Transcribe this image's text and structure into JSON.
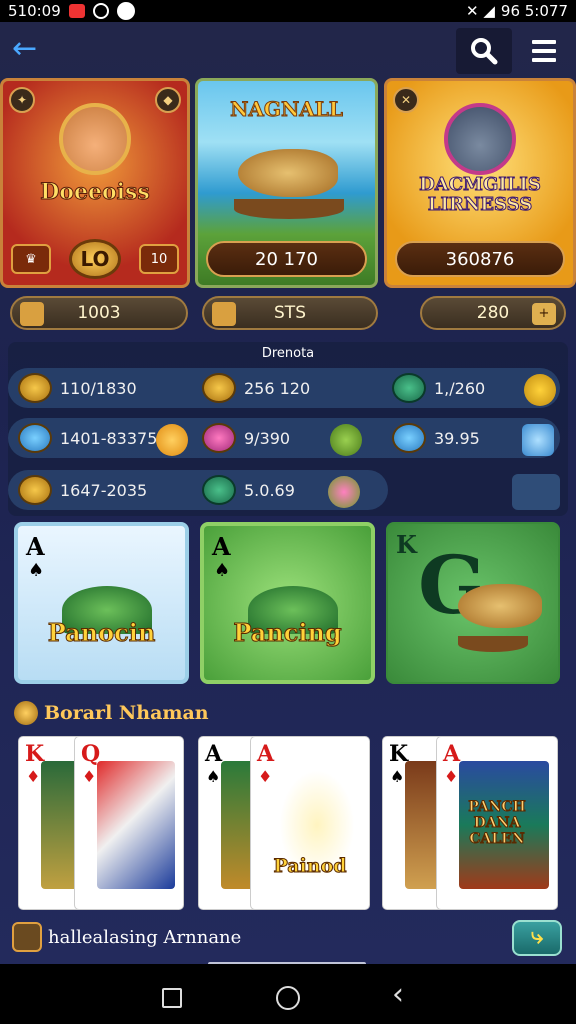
{
  "status": {
    "time": "510:09",
    "right": "96 5:077"
  },
  "app": {
    "accent": "#4aa8ff"
  },
  "game_cards": [
    {
      "title": "Doeeoiss",
      "badge": "LO",
      "small": "10"
    },
    {
      "title": "NAGNALL",
      "value": "20 170"
    },
    {
      "title": "DACMGILIS\nLIRNESSS",
      "value": "360876"
    }
  ],
  "pills": [
    "1003",
    "STS",
    "280"
  ],
  "stats": {
    "title": "Drenota",
    "rows": [
      [
        "110/1830",
        "256 120",
        "1,/260"
      ],
      [
        "1401-83375",
        "9/390",
        "39.95"
      ],
      [
        "1647-2035",
        "5.0.69"
      ]
    ]
  },
  "tiles": [
    {
      "rank": "A",
      "suit": "♠",
      "title": "Panocin"
    },
    {
      "rank": "A",
      "suit": "♠",
      "title": "Pancing"
    },
    {
      "rank": "K",
      "suit": "♦",
      "title": "G"
    }
  ],
  "section": {
    "title": "Borarl Nhaman"
  },
  "hand": [
    {
      "rank": "K",
      "suit": "♦",
      "color": "red"
    },
    {
      "rank": "Q",
      "suit": "♦",
      "color": "red"
    },
    {
      "rank": "A",
      "suit": "♠",
      "color": "blk"
    },
    {
      "rank": "A",
      "suit": "♦",
      "color": "red",
      "caption": "Painod"
    },
    {
      "rank": "K",
      "suit": "♠",
      "color": "blk"
    },
    {
      "rank": "A",
      "suit": "♦",
      "color": "red",
      "caption": "PANCH\nDANA\nCALEN"
    }
  ],
  "bottom": {
    "label": "hallealasing Arnnane",
    "action": "⤷"
  }
}
